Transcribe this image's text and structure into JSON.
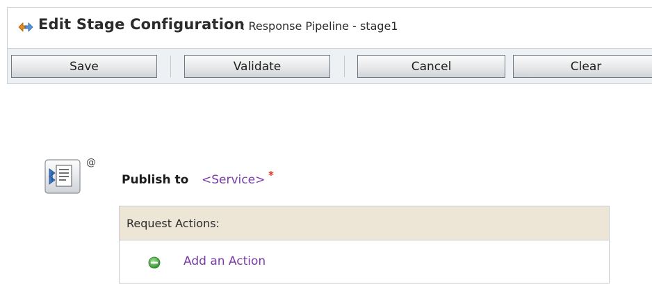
{
  "header": {
    "title": "Edit Stage Configuration",
    "subtitle": ": Response Pipeline - stage1",
    "icon": "stage-config-icon"
  },
  "toolbar": {
    "save_label": "Save",
    "validate_label": "Validate",
    "cancel_label": "Cancel",
    "clear_label": "Clear"
  },
  "stage": {
    "icon": "publish-action-icon",
    "badge": "@",
    "action_label": "Publish to",
    "service_link": "<Service>",
    "required_marker": "*"
  },
  "request_actions": {
    "header_label": "Request Actions:",
    "add_icon": "add-circle-icon",
    "add_link": "Add an Action"
  },
  "colors": {
    "link": "#7a3aa6",
    "required": "#e0301e",
    "panel_header_bg": "#ede6d6",
    "toolbar_bg": "#eef1f4"
  }
}
